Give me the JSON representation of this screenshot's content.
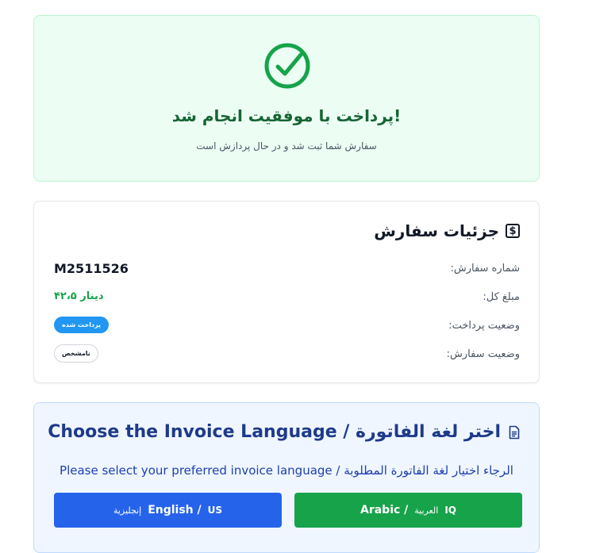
{
  "success": {
    "title": "پرداخت با موفقیت انجام شد!",
    "subtitle": "سفارش شما ثبت شد و در حال پردازش است"
  },
  "details": {
    "title": "جزئیات سفارش",
    "icon": "dollar-icon",
    "order_number_label": "شماره سفارش:",
    "order_number": "M2511526",
    "amount_label": "مبلغ کل:",
    "amount": "۴۲،۵ دینار",
    "payment_status_label": "وضعیت پرداخت:",
    "payment_status": "پرداخت شده",
    "order_status_label": "وضعیت سفارش:",
    "order_status": "نامشخص"
  },
  "language": {
    "title": "Choose the Invoice Language / اختر لغة الفاتورة",
    "subtitle": "Please select your preferred invoice language / الرجاء اختيار لغة الفاتورة المطلوبة",
    "english_button": {
      "flag": "US",
      "label": "English /",
      "native": "إنجليزية"
    },
    "arabic_button": {
      "flag": "IQ",
      "native": "العربية",
      "label": "Arabic /"
    }
  },
  "colors": {
    "success_green": "#16a34a",
    "primary_blue": "#2563eb",
    "badge_blue": "#2196f3",
    "title_navy": "#1e3a8a"
  }
}
